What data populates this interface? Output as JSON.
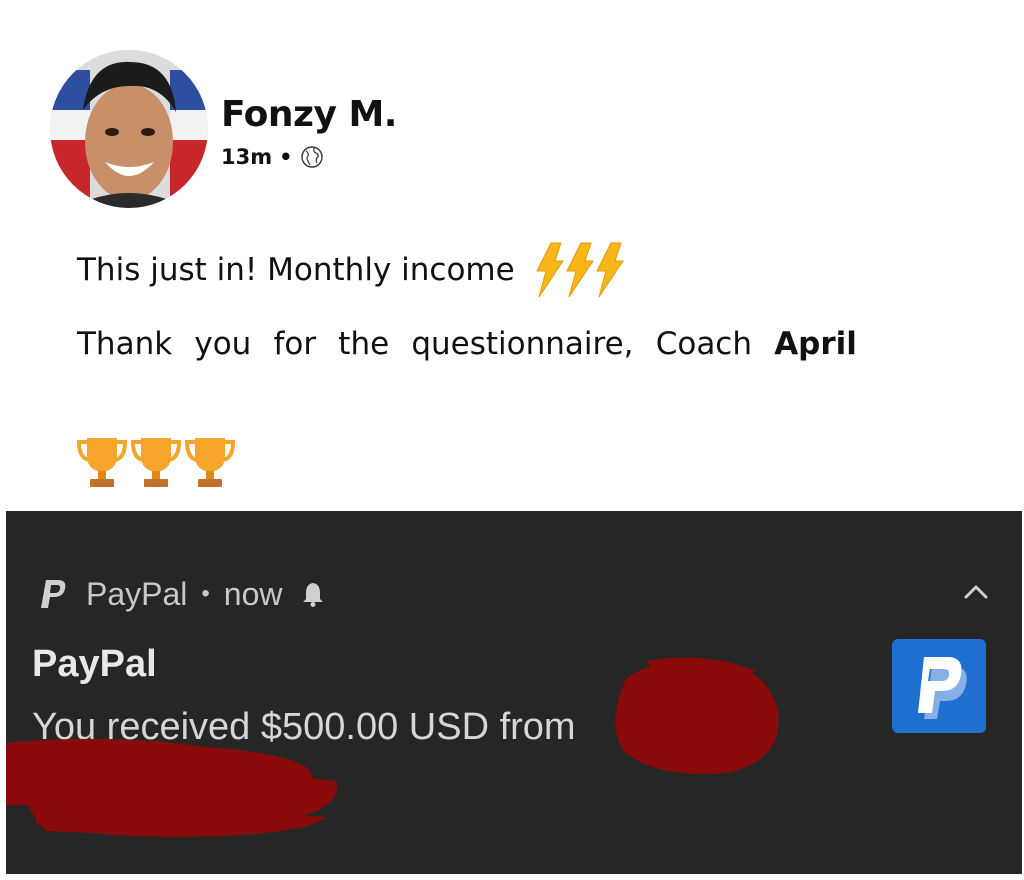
{
  "post": {
    "author_name": "Fonzy M.",
    "timestamp": "13m",
    "separator": "•",
    "visibility_icon": "globe-icon",
    "line1_text": "This just in! Monthly income",
    "line1_icon": "lightning-bolts-icon",
    "line2_words": [
      "Thank",
      "you",
      "for",
      "the",
      "questionnaire,",
      "Coach"
    ],
    "line2_bold": "April",
    "trophy_icon": "trophy-icon",
    "trophy_count": 3
  },
  "notification": {
    "app_name": "PayPal",
    "separator": "•",
    "time": "now",
    "title": "PayPal",
    "body": "You received $500.00 USD from",
    "header_icon": "paypal-logo-icon",
    "bell_icon": "bell-icon",
    "collapse_icon": "chevron-up-icon",
    "app_icon": "paypal-app-icon"
  },
  "colors": {
    "notification_bg": "#262626",
    "paypal_blue": "#1f6fd1",
    "redaction": "#8b0a0a"
  }
}
